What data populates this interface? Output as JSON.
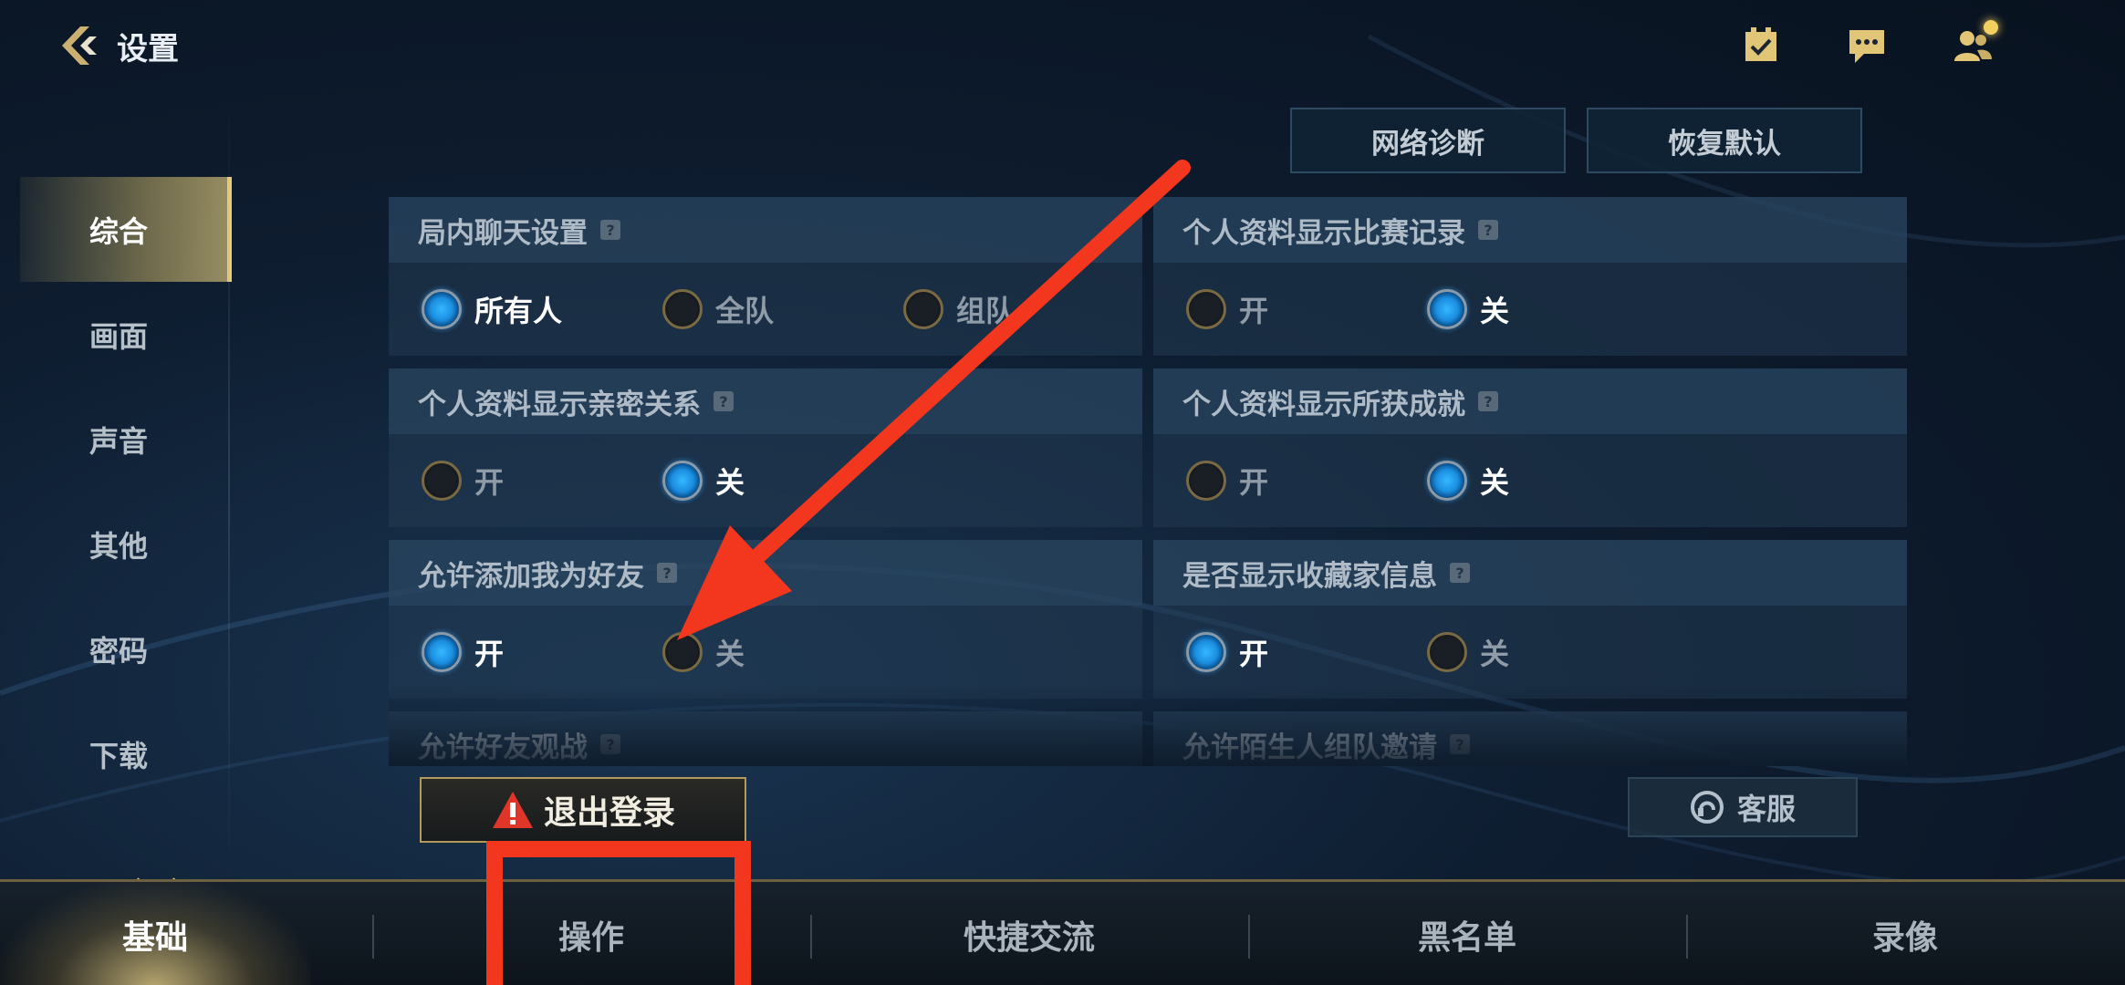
{
  "header": {
    "title": "设置",
    "icons": [
      "task-check-icon",
      "chat-icon",
      "friends-icon"
    ]
  },
  "sidebar": {
    "items": [
      {
        "label": "综合",
        "active": true
      },
      {
        "label": "画面"
      },
      {
        "label": "声音"
      },
      {
        "label": "其他"
      },
      {
        "label": "密码"
      },
      {
        "label": "下载"
      }
    ]
  },
  "top_buttons": {
    "network": "网络诊断",
    "reset": "恢复默认"
  },
  "settings": [
    {
      "title": "局内聊天设置",
      "options": [
        "所有人",
        "全队",
        "组队"
      ],
      "selected": 0
    },
    {
      "title": "个人资料显示比赛记录",
      "options": [
        "开",
        "关"
      ],
      "selected": 1
    },
    {
      "title": "个人资料显示亲密关系",
      "options": [
        "开",
        "关"
      ],
      "selected": 1
    },
    {
      "title": "个人资料显示所获成就",
      "options": [
        "开",
        "关"
      ],
      "selected": 1
    },
    {
      "title": "允许添加我为好友",
      "options": [
        "开",
        "关"
      ],
      "selected": 0
    },
    {
      "title": "是否显示收藏家信息",
      "options": [
        "开",
        "关"
      ],
      "selected": 0
    },
    {
      "title": "允许好友观战"
    },
    {
      "title": "允许陌生人组队邀请"
    }
  ],
  "help_mark": "?",
  "logout": {
    "label": "退出登录"
  },
  "service": {
    "label": "客服"
  },
  "bottom_tabs": [
    {
      "label": "基础",
      "active": true
    },
    {
      "label": "操作"
    },
    {
      "label": "快捷交流"
    },
    {
      "label": "黑名单"
    },
    {
      "label": "录像"
    }
  ],
  "colors": {
    "accent_gold": "#e8cc7a",
    "radio_on": "#35b8ff",
    "annotation_red": "#f2371e"
  }
}
